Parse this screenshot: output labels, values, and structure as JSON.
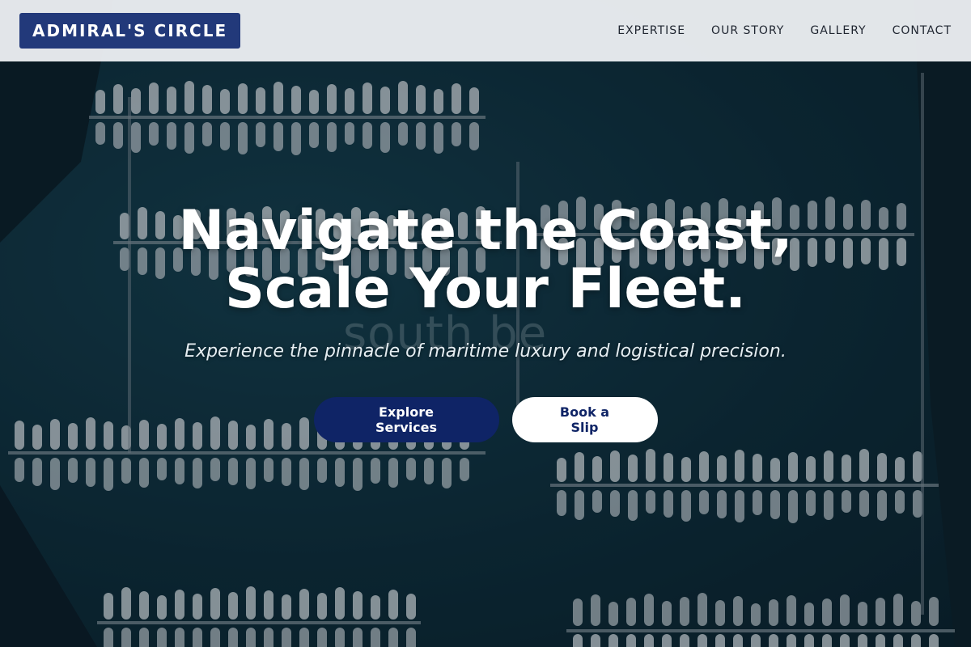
{
  "header": {
    "logo_text": "ADMIRAL'S CIRCLE",
    "nav": [
      {
        "label": "EXPERTISE"
      },
      {
        "label": "OUR STORY"
      },
      {
        "label": "GALLERY"
      },
      {
        "label": "CONTACT"
      }
    ]
  },
  "hero": {
    "title_line1": "Navigate the Coast,",
    "title_line2": "Scale Your Fleet.",
    "subtitle": "Experience the pinnacle of maritime luxury and logistical precision.",
    "primary_cta": "Explore Services",
    "secondary_cta": "Book a Slip",
    "background_watermark": "south be"
  },
  "colors": {
    "brand_navy": "#22397a",
    "button_navy": "#0f2466",
    "water": "#0d2c38"
  }
}
